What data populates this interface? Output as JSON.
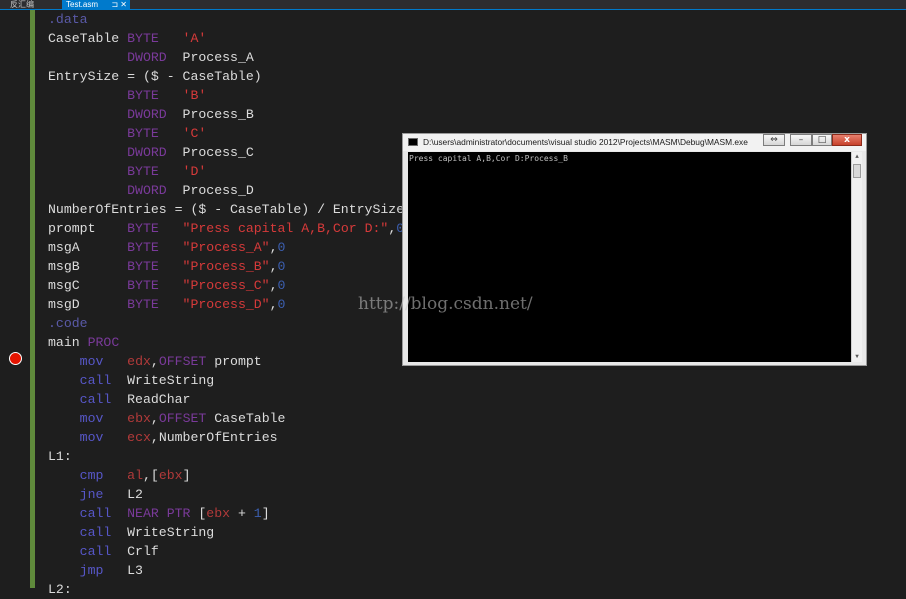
{
  "tabs": [
    {
      "label": "反汇编",
      "active": false
    },
    {
      "label": "Test.asm",
      "active": true,
      "pin_icon": "pin-icon",
      "close_icon": "close-icon"
    }
  ],
  "colors": {
    "editor_background": "#1e1e1e",
    "directive": "#5a5aa8",
    "text": "#dcdcdc",
    "type": "#7a3a9a",
    "string": "#d63a3a",
    "number": "#3c5fb0",
    "keyword": "#5757c8",
    "register": "#b23a3a",
    "change_bar": "#5f8a3b",
    "breakpoint": "#e51400"
  },
  "breakpoint_line": 19,
  "code_lines": [
    [
      [
        "dir",
        ".data"
      ]
    ],
    [
      [
        "text",
        "CaseTable "
      ],
      [
        "type",
        "BYTE"
      ],
      [
        "text",
        "   "
      ],
      [
        "str",
        "'A'"
      ]
    ],
    [
      [
        "text",
        "          "
      ],
      [
        "type",
        "DWORD"
      ],
      [
        "text",
        "  Process_A"
      ]
    ],
    [
      [
        "text",
        "EntrySize = ($ - CaseTable)"
      ]
    ],
    [
      [
        "text",
        "          "
      ],
      [
        "type",
        "BYTE"
      ],
      [
        "text",
        "   "
      ],
      [
        "str",
        "'B'"
      ]
    ],
    [
      [
        "text",
        "          "
      ],
      [
        "type",
        "DWORD"
      ],
      [
        "text",
        "  Process_B"
      ]
    ],
    [
      [
        "text",
        "          "
      ],
      [
        "type",
        "BYTE"
      ],
      [
        "text",
        "   "
      ],
      [
        "str",
        "'C'"
      ]
    ],
    [
      [
        "text",
        "          "
      ],
      [
        "type",
        "DWORD"
      ],
      [
        "text",
        "  Process_C"
      ]
    ],
    [
      [
        "text",
        "          "
      ],
      [
        "type",
        "BYTE"
      ],
      [
        "text",
        "   "
      ],
      [
        "str",
        "'D'"
      ]
    ],
    [
      [
        "text",
        "          "
      ],
      [
        "type",
        "DWORD"
      ],
      [
        "text",
        "  Process_D"
      ]
    ],
    [
      [
        "text",
        "NumberOfEntries = ($ - CaseTable) / EntrySize"
      ]
    ],
    [
      [
        "text",
        "prompt    "
      ],
      [
        "type",
        "BYTE"
      ],
      [
        "text",
        "   "
      ],
      [
        "str",
        "\"Press capital A,B,Cor D:\""
      ],
      [
        "text",
        ","
      ],
      [
        "num",
        "0"
      ]
    ],
    [
      [
        "text",
        "msgA      "
      ],
      [
        "type",
        "BYTE"
      ],
      [
        "text",
        "   "
      ],
      [
        "str",
        "\"Process_A\""
      ],
      [
        "text",
        ","
      ],
      [
        "num",
        "0"
      ]
    ],
    [
      [
        "text",
        "msgB      "
      ],
      [
        "type",
        "BYTE"
      ],
      [
        "text",
        "   "
      ],
      [
        "str",
        "\"Process_B\""
      ],
      [
        "text",
        ","
      ],
      [
        "num",
        "0"
      ]
    ],
    [
      [
        "text",
        "msgC      "
      ],
      [
        "type",
        "BYTE"
      ],
      [
        "text",
        "   "
      ],
      [
        "str",
        "\"Process_C\""
      ],
      [
        "text",
        ","
      ],
      [
        "num",
        "0"
      ]
    ],
    [
      [
        "text",
        "msgD      "
      ],
      [
        "type",
        "BYTE"
      ],
      [
        "text",
        "   "
      ],
      [
        "str",
        "\"Process_D\""
      ],
      [
        "text",
        ","
      ],
      [
        "num",
        "0"
      ]
    ],
    [
      [
        "dir",
        ".code"
      ]
    ],
    [
      [
        "text",
        "main "
      ],
      [
        "type",
        "PROC"
      ]
    ],
    [
      [
        "text",
        "    "
      ],
      [
        "kw",
        "mov"
      ],
      [
        "text",
        "   "
      ],
      [
        "reg",
        "edx"
      ],
      [
        "text",
        ","
      ],
      [
        "type",
        "OFFSET"
      ],
      [
        "text",
        " prompt"
      ]
    ],
    [
      [
        "text",
        "    "
      ],
      [
        "kw",
        "call"
      ],
      [
        "text",
        "  WriteString"
      ]
    ],
    [
      [
        "text",
        "    "
      ],
      [
        "kw",
        "call"
      ],
      [
        "text",
        "  ReadChar"
      ]
    ],
    [
      [
        "text",
        "    "
      ],
      [
        "kw",
        "mov"
      ],
      [
        "text",
        "   "
      ],
      [
        "reg",
        "ebx"
      ],
      [
        "text",
        ","
      ],
      [
        "type",
        "OFFSET"
      ],
      [
        "text",
        " CaseTable"
      ]
    ],
    [
      [
        "text",
        "    "
      ],
      [
        "kw",
        "mov"
      ],
      [
        "text",
        "   "
      ],
      [
        "reg",
        "ecx"
      ],
      [
        "text",
        ",NumberOfEntries"
      ]
    ],
    [
      [
        "text",
        "L1:"
      ]
    ],
    [
      [
        "text",
        "    "
      ],
      [
        "kw",
        "cmp"
      ],
      [
        "text",
        "   "
      ],
      [
        "reg",
        "al"
      ],
      [
        "text",
        ",["
      ],
      [
        "reg",
        "ebx"
      ],
      [
        "text",
        "]"
      ]
    ],
    [
      [
        "text",
        "    "
      ],
      [
        "kw",
        "jne"
      ],
      [
        "text",
        "   L2"
      ]
    ],
    [
      [
        "text",
        "    "
      ],
      [
        "kw",
        "call"
      ],
      [
        "text",
        "  "
      ],
      [
        "type",
        "NEAR PTR"
      ],
      [
        "text",
        " ["
      ],
      [
        "reg",
        "ebx"
      ],
      [
        "text",
        " + "
      ],
      [
        "num",
        "1"
      ],
      [
        "text",
        "]"
      ]
    ],
    [
      [
        "text",
        "    "
      ],
      [
        "kw",
        "call"
      ],
      [
        "text",
        "  WriteString"
      ]
    ],
    [
      [
        "text",
        "    "
      ],
      [
        "kw",
        "call"
      ],
      [
        "text",
        "  Crlf"
      ]
    ],
    [
      [
        "text",
        "    "
      ],
      [
        "kw",
        "jmp"
      ],
      [
        "text",
        "   L3"
      ]
    ],
    [
      [
        "text",
        "L2:"
      ]
    ]
  ],
  "console": {
    "title": "D:\\users\\administrator\\documents\\visual studio 2012\\Projects\\MASM\\Debug\\MASM.exe",
    "output": "Press capital A,B,Cor D:Process_B",
    "buttons": {
      "resize": "⇔",
      "minimize": "–",
      "maximize": "□",
      "close": "x"
    }
  },
  "watermark": "http://blog.csdn.net/"
}
